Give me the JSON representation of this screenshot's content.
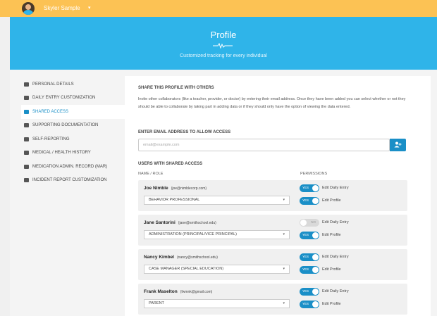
{
  "topbar": {
    "username": "Skyler Sample",
    "caret": "▾"
  },
  "hero": {
    "title": "Profile",
    "subtitle": "Customized tracking for every individual"
  },
  "sidebar": {
    "items": [
      {
        "label": "Personal Details",
        "icon": "id-card-icon"
      },
      {
        "label": "Daily Entry Customization",
        "icon": "calendar-icon"
      },
      {
        "label": "Shared Access",
        "icon": "users-icon",
        "active": true
      },
      {
        "label": "Supporting Documentation",
        "icon": "paperclip-icon"
      },
      {
        "label": "Self-Reporting",
        "icon": "circle-user-icon"
      },
      {
        "label": "Medical / Health History",
        "icon": "heartbeat-icon"
      },
      {
        "label": "Medication Admin. Record (MAR)",
        "icon": "pill-box-icon"
      },
      {
        "label": "Incident Report Customization",
        "icon": "document-icon"
      }
    ]
  },
  "share": {
    "title": "Share this profile with others",
    "description": "Invite other collaborators (like a teacher, provider, or doctor) by entering their email address. Once they have been added you can select whether or not they should be able to collaborate by taking part in adding data or if they should only have the option of viewing the data entered."
  },
  "email": {
    "label": "Enter email address to allow access",
    "placeholder": "email@example.com"
  },
  "users_section": {
    "title": "Users with shared access",
    "col_name": "Name / Role",
    "col_permissions": "Permissions",
    "perm_daily_label": "Edit Daily Entry",
    "perm_profile_label": "Edit Profile",
    "yes": "YES",
    "no": "NO",
    "dropdown_caret": "▾",
    "users": [
      {
        "name": "Joe Nimble",
        "email": "(joe@nimblecorp.com)",
        "role": "Behavior Professional",
        "daily": true,
        "profile": true
      },
      {
        "name": "Jane Santorini",
        "email": "(jane@smithschool.edu)",
        "role": "Administration (Principal/Vice Principal)",
        "daily": false,
        "profile": true
      },
      {
        "name": "Nancy Kimbel",
        "email": "(nancy@smithschool.edu)",
        "role": "Case Manager (Special Education)",
        "daily": true,
        "profile": true
      },
      {
        "name": "Frank Maselton",
        "email": "(fwmnk@gmail.com)",
        "role": "Parent",
        "daily": true,
        "profile": true
      }
    ]
  },
  "colors": {
    "accent": "#2fb4e9",
    "topbar": "#fcc254",
    "active": "#1a8fc7"
  }
}
